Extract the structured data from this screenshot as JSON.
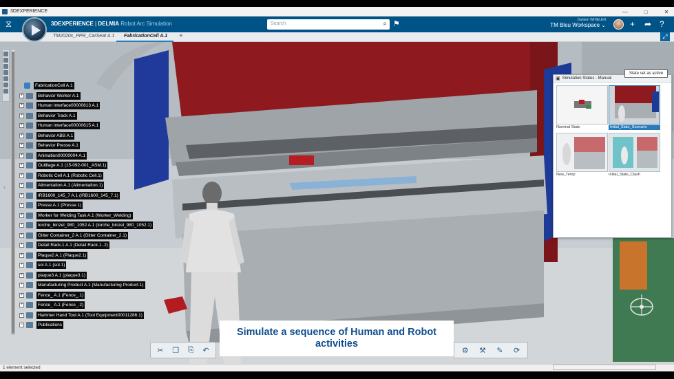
{
  "window": {
    "title": "3DEXPERIENCE",
    "controls": [
      "—",
      "□",
      "✕"
    ]
  },
  "header": {
    "brand_prefix": "3DEXPERIENCE",
    "brand_sep": " | ",
    "brand_company": "DELMIA",
    "app_name": "Robot Arc Simulation",
    "search_placeholder": "Search",
    "user_name": "Damien WHIELEN",
    "workspace": "TM Bleu Workspace",
    "icons": [
      "ds-logo-icon",
      "compass-icon",
      "search-icon",
      "tag-icon",
      "add-icon",
      "share-icon",
      "help-icon"
    ]
  },
  "tabs": [
    {
      "label": "TM2020x_PPR_CarSeat A.1",
      "active": false
    },
    {
      "label": "FabricationCell A.1",
      "active": true
    }
  ],
  "tree": {
    "root": "FabricationCell A.1",
    "items": [
      "Behavior Worker A.1",
      "Human Interface00000613 A.1",
      "Behavior Track A.1",
      "Human Interface00000615 A.1",
      "Behavior ABB A.1",
      "Behavior Presse A.1",
      "Animation00000004 A.1",
      "Outillage A.1 (15-092-001_ASM.1)",
      "Robotic Cell A.1 (Robotic Cell.1)",
      "Alimentation A.1 (Alimentation.1)",
      "IRB1600_145_7 A.1 (IRB1600_145_7.1)",
      "Presse A.1 (Presse.1)",
      "Worker for Welding Task A.1 (Worker_Welding)",
      "torche_binzel_980_1052 A.1 (torche_binzel_980_1052.1)",
      "Gitter Container_2 A.1 (Gitter Container_2.1)",
      "Detail Rack.1 A.1 (Detail Rack.1..2)",
      "Plaque2 A.1 (Plaque2.1)",
      "sol A.1 (sol.1)",
      "plaque3 A.1 (plaque3.1)",
      "Manufacturing Product A.1 (Manufacturing Product.1)",
      "Fence_ A.1 (Fence_.1)",
      "Fence_ A.1 (Fence_.2)",
      "Hammer Hand Tool A.1 (Tool Equipment00011286.1)",
      "Publications"
    ]
  },
  "sim_panel": {
    "title": "Simulation States - Manual",
    "tooltip": "State set as active",
    "states": [
      {
        "name": "Nominal State",
        "active": false
      },
      {
        "name": "Initial_State_Scenario",
        "active": true
      },
      {
        "name": "New_Temp",
        "active": false
      },
      {
        "name": "Initial_State_Clash",
        "active": false
      }
    ]
  },
  "caption": {
    "line1": "Simulate a sequence of Human and Robot",
    "line2": "activities"
  },
  "toolbar": {
    "icons_left": [
      "cut-icon",
      "copy-icon",
      "paste-icon",
      "undo-icon"
    ],
    "icons_right": [
      "sim-tool-icon",
      "robot-tool-icon",
      "teach-icon",
      "motion-icon"
    ]
  },
  "status": {
    "text": "1 element selected"
  },
  "colors": {
    "header": "#005386",
    "accent": "#2a7ab8",
    "caption_text": "#0f4d8f",
    "press_red": "#8e1a1f"
  }
}
